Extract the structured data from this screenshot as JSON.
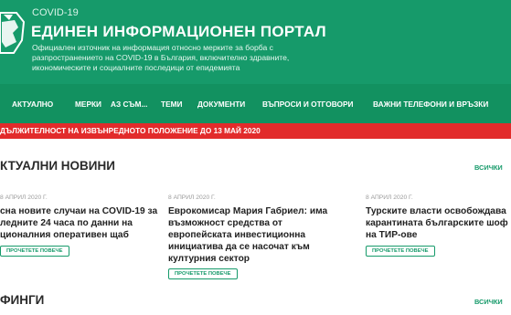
{
  "header": {
    "covid_label": "COVID-19",
    "title": "ЕДИНЕН ИНФОРМАЦИОНЕН ПОРТАЛ",
    "subtitle": "Официален източник на информация относно мерките за борба с разпространението на COVID-19 в България, включително здравните, икономическите и социалните последици от епидемията"
  },
  "nav": {
    "items": [
      "АКТУАЛНО",
      "МЕРКИ",
      "АЗ СЪМ...",
      "ТЕМИ",
      "ДОКУМЕНТИ",
      "ВЪПРОСИ И ОТГОВОРИ",
      "ВАЖНИ ТЕЛЕФОНИ И ВРЪЗКИ"
    ]
  },
  "alert": {
    "text": "ДЪЛЖИТЕЛНОСТ НА ИЗВЪНРЕДНОТО ПОЛОЖЕНИЕ ДО 13 МАЙ 2020"
  },
  "news": {
    "title": "КТУАЛНИ НОВИНИ",
    "see_all": "ВСИЧКИ",
    "items": [
      {
        "date": "8 АПРИЛ 2020 Г.",
        "lines": [
          "сна новите случаи на COVID-19 за",
          "ледните 24 часа по данни на",
          "ционалния оперативен щаб"
        ],
        "read_more": "ПРОЧЕТЕТЕ ПОВЕЧЕ"
      },
      {
        "date": "8 АПРИЛ 2020 Г.",
        "lines": [
          "Еврокомисар Мария Габриел: има",
          "възможност средства от",
          "европейската инвестиционна",
          "инициатива да се насочат към",
          "културния сектор"
        ],
        "read_more": "ПРОЧЕТЕТЕ ПОВЕЧЕ"
      },
      {
        "date": "8 АПРИЛ 2020 Г.",
        "lines": [
          "Турските власти освобождава",
          "карантината българските шоф",
          "на ТИР-ове"
        ],
        "read_more": "ПРОЧЕТЕТЕ ПОВЕЧЕ"
      }
    ]
  },
  "briefings": {
    "title": "ФИНГИ",
    "see_all": "ВСИЧКИ"
  },
  "colors": {
    "header_green": "#169a6a",
    "nav_green": "#129160",
    "alert_red": "#e22b2b"
  }
}
